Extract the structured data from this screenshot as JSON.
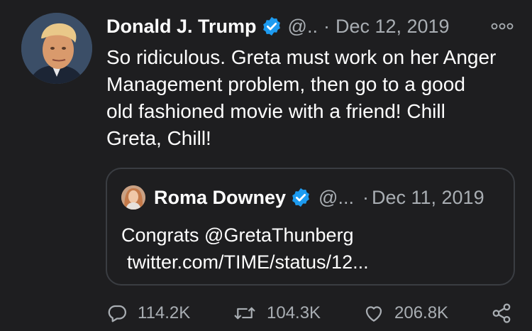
{
  "tweet": {
    "author_name": "Donald J. Trump",
    "handle": "@..",
    "separator": "·",
    "date": "Dec 12, 2019",
    "text": "So ridiculous. Greta must work on her Anger\nManagement problem, then go to a good\nold fashioned movie with a friend! Chill\nGreta, Chill!"
  },
  "quote": {
    "author_name": "Roma Downey",
    "handle": "@...",
    "separator": "·",
    "date": "Dec 11, 2019",
    "text_line1": "Congrats @GretaThunberg",
    "text_line2": "twitter.com/TIME/status/12..."
  },
  "actions": {
    "reply_count": "114.2K",
    "retweet_count": "104.3K",
    "like_count": "206.8K"
  },
  "icons": {
    "verified": "verified-badge-icon",
    "more": "more-options-icon",
    "reply": "comment-icon",
    "retweet": "retweet-icon",
    "like": "heart-icon",
    "share": "share-icon"
  },
  "colors": {
    "background": "#1e1e20",
    "text": "#ffffff",
    "secondary_text": "#a9aeb3",
    "verified_blue": "#1d9bf0",
    "quote_border": "#3a3d42"
  }
}
